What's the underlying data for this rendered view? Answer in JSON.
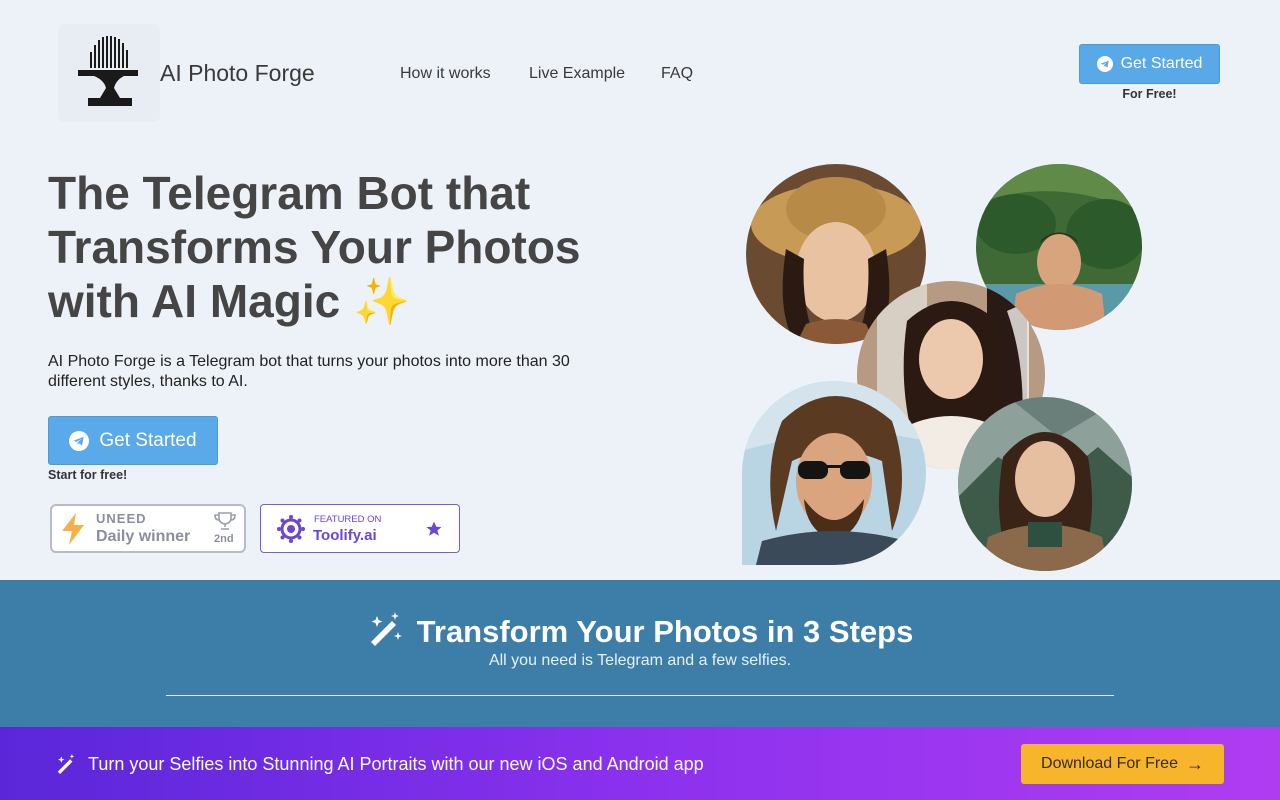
{
  "header": {
    "brand": "AI Photo Forge",
    "nav": [
      {
        "label": "How it works"
      },
      {
        "label": "Live Example"
      },
      {
        "label": "FAQ"
      }
    ],
    "cta_label": "Get Started",
    "cta_sub": "For Free!"
  },
  "hero": {
    "title_line1": "The Telegram Bot that",
    "title_line2": "Transforms Your Photos",
    "title_line3": "with AI Magic",
    "title_emoji": "✨",
    "description": "AI Photo Forge is a Telegram bot that turns your photos into more than 30 different styles, thanks to AI.",
    "cta_label": "Get Started",
    "cta_sub": "Start for free!"
  },
  "badges": {
    "uneed_brand": "UNEED",
    "uneed_label": "Daily winner",
    "uneed_rank": "2nd",
    "toolify_top": "FEATURED ON",
    "toolify_name": "Toolify.ai"
  },
  "steps": {
    "title": "Transform Your Photos in 3 Steps",
    "subtitle": "All you need is Telegram and a few selfies."
  },
  "banner": {
    "text": "Turn your Selfies into Stunning AI Portraits with our new iOS and Android app",
    "button_label": "Download For Free",
    "button_arrow": "→"
  },
  "colors": {
    "telegram_blue": "#59a9e8",
    "steps_bg": "#3c7ea8",
    "banner_start": "#5a27d8",
    "banner_end": "#b03cf2",
    "download_btn": "#f6b52b"
  },
  "icons": [
    "anvil-logo-icon",
    "telegram-icon",
    "lightning-icon",
    "trophy-icon",
    "toolify-logo-icon",
    "star-icon",
    "magic-wand-icon",
    "arrow-right-icon"
  ]
}
